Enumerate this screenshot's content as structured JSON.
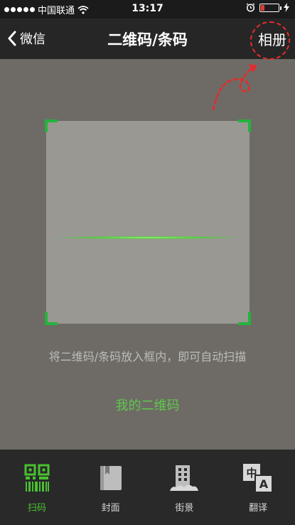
{
  "status_bar": {
    "carrier": "中国联通",
    "time": "13:17"
  },
  "nav": {
    "back_label": "微信",
    "title": "二维码/条码",
    "right_label": "相册"
  },
  "scanner": {
    "hint": "将二维码/条码放入框内，即可自动扫描",
    "my_qr_label": "我的二维码"
  },
  "tabs": [
    {
      "label": "扫码",
      "icon": "qr-barcode-icon",
      "active": true
    },
    {
      "label": "封面",
      "icon": "book-icon",
      "active": false
    },
    {
      "label": "街景",
      "icon": "building-icon",
      "active": false
    },
    {
      "label": "翻译",
      "icon": "translate-icon",
      "active": false
    }
  ],
  "colors": {
    "accent_green": "#49c230",
    "annotation_red": "#e52b2b",
    "battery_low": "#e53935"
  }
}
